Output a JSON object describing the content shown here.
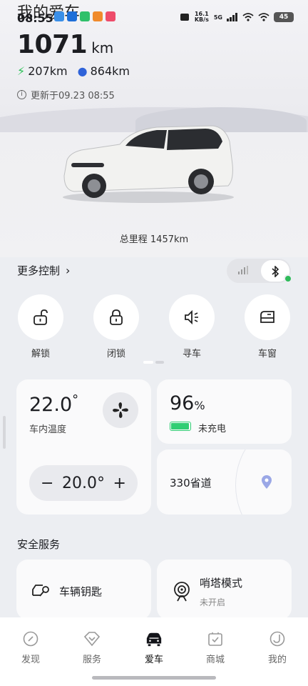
{
  "status_bar": {
    "time": "08:55",
    "speed": "16.1 KB/s",
    "network": "5G",
    "battery": "45"
  },
  "header": {
    "title": "我的爱车",
    "total_range": "1071",
    "range_unit": "km",
    "electric_range": "207km",
    "fuel_range": "864km",
    "updated": "更新于09.23 08:55"
  },
  "odometer": "总里程 1457km",
  "more_controls": {
    "label": "更多控制",
    "connection": "bluetooth",
    "connected": true
  },
  "controls": [
    {
      "label": "解锁",
      "icon": "unlock-icon"
    },
    {
      "label": "闭锁",
      "icon": "lock-icon"
    },
    {
      "label": "寻车",
      "icon": "horn-icon"
    },
    {
      "label": "车窗",
      "icon": "window-icon"
    }
  ],
  "climate": {
    "cabin_temp": "22.0",
    "degree": "°",
    "cabin_label": "车内温度",
    "set_temp": "20.0°",
    "minus": "−",
    "plus": "+"
  },
  "battery": {
    "percent": "96",
    "percent_sign": "%",
    "status": "未充电",
    "level": 0.96
  },
  "location": {
    "road": "330省道"
  },
  "safety": {
    "title": "安全服务",
    "key_label": "车辆钥匙",
    "sentry_label": "哨塔模式",
    "sentry_status": "未开启"
  },
  "tabs": [
    {
      "label": "发现",
      "icon": "compass-icon"
    },
    {
      "label": "服务",
      "icon": "service-icon"
    },
    {
      "label": "爱车",
      "icon": "car-icon",
      "active": true
    },
    {
      "label": "商城",
      "icon": "shop-icon"
    },
    {
      "label": "我的",
      "icon": "profile-icon"
    }
  ],
  "colors": {
    "accent_green": "#27c052",
    "fuel_blue": "#2f63d9",
    "battery_green": "#2fce73"
  }
}
